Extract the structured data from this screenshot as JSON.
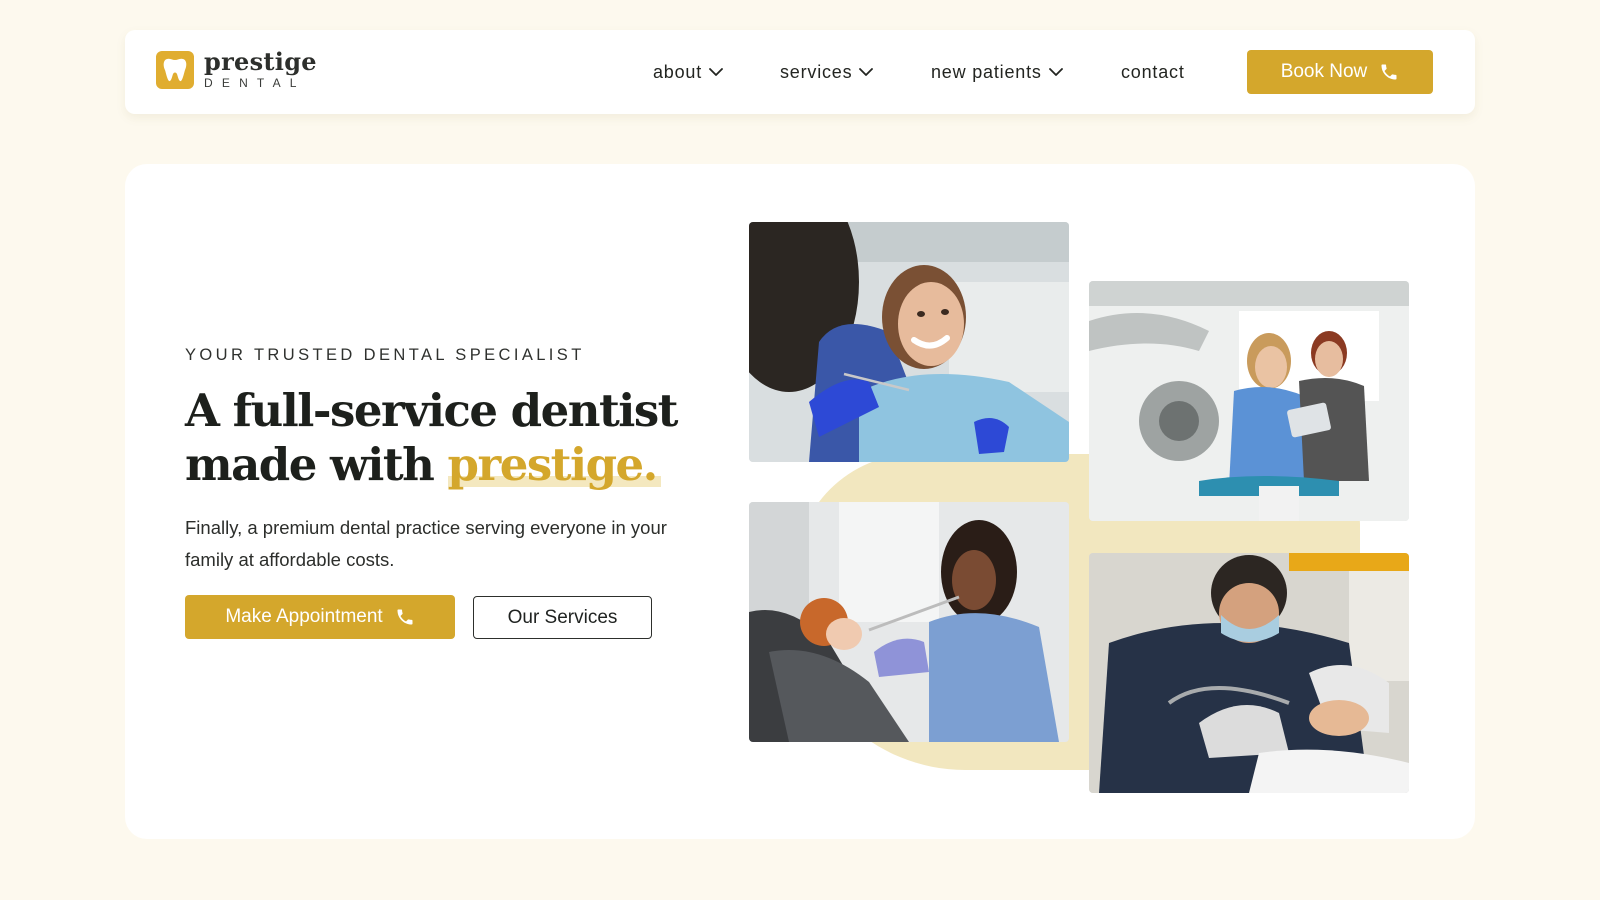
{
  "brand": {
    "name": "prestige",
    "sub": "DENTAL",
    "accent_color": "#d4a72c",
    "logo_icon": "tooth-icon"
  },
  "nav": {
    "items": [
      {
        "label": "about",
        "has_dropdown": true
      },
      {
        "label": "services",
        "has_dropdown": true
      },
      {
        "label": "new patients",
        "has_dropdown": true
      },
      {
        "label": "contact",
        "has_dropdown": false
      }
    ],
    "cta_label": "Book Now",
    "cta_icon": "phone-icon"
  },
  "hero": {
    "eyebrow": "YOUR TRUSTED DENTAL SPECIALIST",
    "headline_line1": "A full-service dentist",
    "headline_line2_prefix": "made with",
    "headline_accent": "prestige.",
    "subtext": "Finally, a premium dental practice serving everyone in your family at affordable costs.",
    "primary_button": "Make Appointment",
    "primary_button_icon": "phone-icon",
    "secondary_button": "Our Services"
  },
  "photos": [
    {
      "subject": "smiling woman patient in dental chair with dentist in blue gloves"
    },
    {
      "subject": "dental assistant showing tablet to patient in clinic"
    },
    {
      "subject": "dentist examining young red-haired girl's teeth"
    },
    {
      "subject": "masked dentist performing procedure on patient"
    }
  ]
}
